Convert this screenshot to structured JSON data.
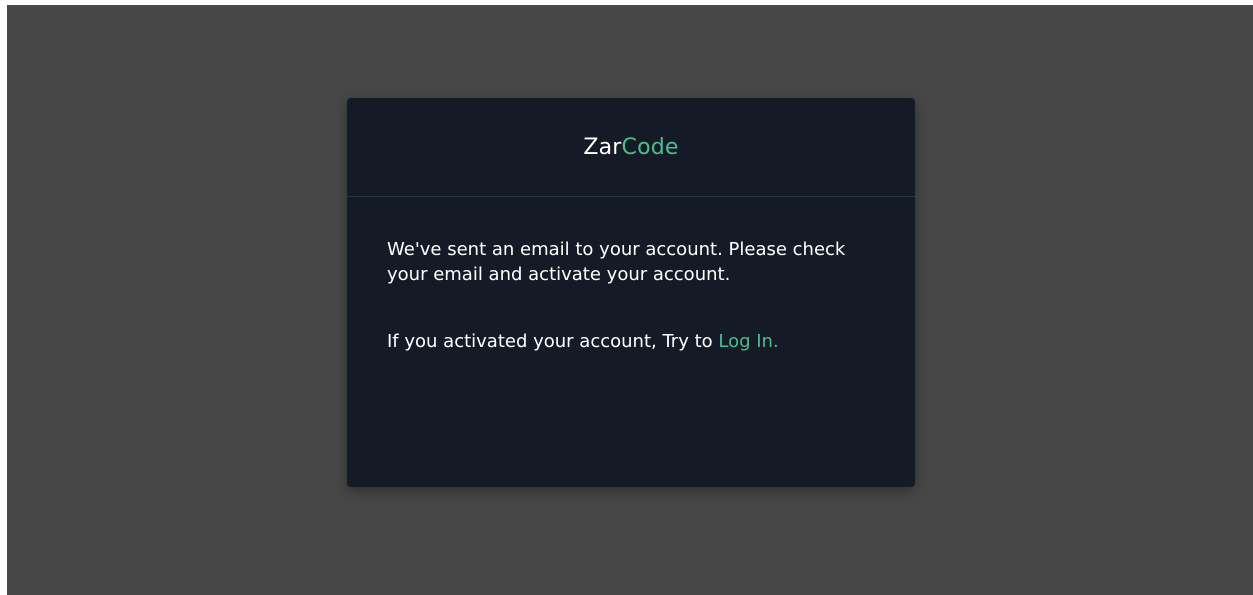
{
  "brand": {
    "part1": "Zar",
    "part2": "Code",
    "accent_color": "#4dbd8e"
  },
  "message": {
    "line1": "We've sent an email to your account. Please check your email and activate your account.",
    "line2_prefix": "If you activated your account, Try to ",
    "link_label": "Log In."
  },
  "colors": {
    "backdrop": "#474747",
    "card": "#151b26",
    "text": "#ffffff"
  }
}
